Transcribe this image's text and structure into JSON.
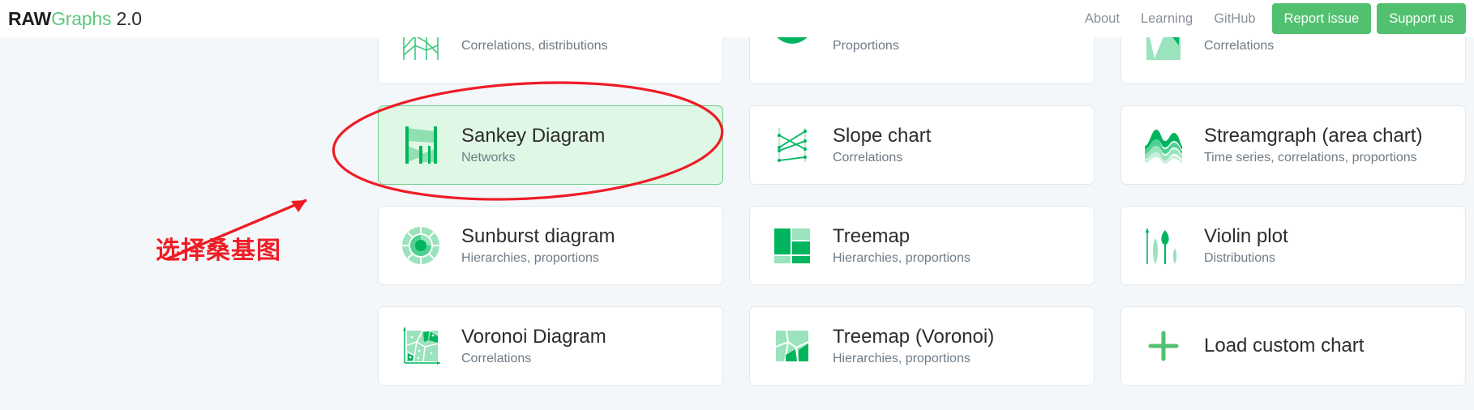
{
  "header": {
    "logo": {
      "raw": "RAW",
      "graphs": "Graphs",
      "version": "2.0"
    },
    "nav_links": [
      {
        "label": "About",
        "name": "nav-link-about"
      },
      {
        "label": "Learning",
        "name": "nav-link-learning"
      },
      {
        "label": "GitHub",
        "name": "nav-link-github"
      }
    ],
    "buttons": [
      {
        "label": "Report issue",
        "name": "report-issue-button"
      },
      {
        "label": "Support us",
        "name": "support-us-button"
      }
    ]
  },
  "colors": {
    "brand_green": "#51c16f",
    "icon_green": "#00b55e",
    "icon_green_light": "#99e0b8",
    "selected_bg": "#dff7e5",
    "selected_border": "#6fcf8c",
    "page_bg": "#f4f7fa",
    "card_bg": "#ffffff",
    "card_border": "#e3e8ec",
    "annotation_red": "#ee1c25",
    "title_text": "#2d2d2d",
    "sub_text": "#6e7b87",
    "nav_text": "#8a9199"
  },
  "chart_gallery": {
    "cards": [
      {
        "title": "",
        "subtitle": "Correlations, distributions",
        "icon": "line-chart-icon",
        "selected": false,
        "clipped": true
      },
      {
        "title": "",
        "subtitle": "Proportions",
        "icon": "pie-arc-icon",
        "selected": false,
        "clipped": true
      },
      {
        "title": "",
        "subtitle": "Correlations",
        "icon": "area-polygon-icon",
        "selected": false,
        "clipped": true
      },
      {
        "title": "Sankey Diagram",
        "subtitle": "Networks",
        "icon": "sankey-icon",
        "selected": true,
        "clipped": false
      },
      {
        "title": "Slope chart",
        "subtitle": "Correlations",
        "icon": "slope-chart-icon",
        "selected": false,
        "clipped": false
      },
      {
        "title": "Streamgraph (area chart)",
        "subtitle": "Time series, correlations, proportions",
        "icon": "streamgraph-icon",
        "selected": false,
        "clipped": false
      },
      {
        "title": "Sunburst diagram",
        "subtitle": "Hierarchies, proportions",
        "icon": "sunburst-icon",
        "selected": false,
        "clipped": false
      },
      {
        "title": "Treemap",
        "subtitle": "Hierarchies, proportions",
        "icon": "treemap-icon",
        "selected": false,
        "clipped": false
      },
      {
        "title": "Violin plot",
        "subtitle": "Distributions",
        "icon": "violin-plot-icon",
        "selected": false,
        "clipped": false
      },
      {
        "title": "Voronoi Diagram",
        "subtitle": "Correlations",
        "icon": "voronoi-icon",
        "selected": false,
        "clipped": false
      },
      {
        "title": "Treemap (Voronoi)",
        "subtitle": "Hierarchies, proportions",
        "icon": "treemap-voronoi-icon",
        "selected": false,
        "clipped": false
      },
      {
        "title": "Load custom chart",
        "subtitle": "",
        "icon": "plus-icon",
        "selected": false,
        "clipped": false
      }
    ]
  },
  "annotation": {
    "label": "选择桑基图",
    "shape": "red-ellipse-highlight",
    "arrow": "red-arrow-pointing-to-sankey-card"
  }
}
